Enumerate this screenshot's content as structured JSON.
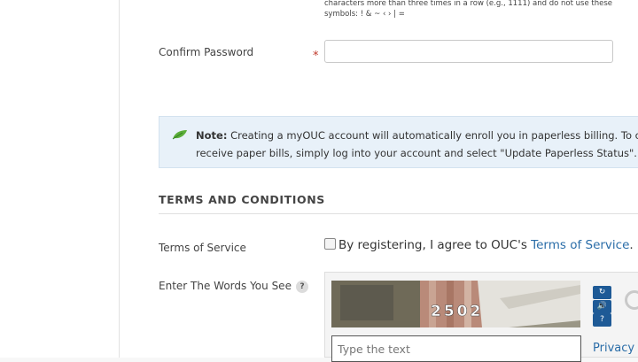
{
  "password_hint": "characters more than three times in a row (e.g., 1111) and do not use these symbols: ! & ~ ‹ › | =",
  "confirm_password": {
    "label": "Confirm Password",
    "required_marker": "*",
    "value": ""
  },
  "note": {
    "prefix": "Note:",
    "line1": " Creating a myOUC account will automatically enroll you in paperless billing. To conti",
    "line2": "receive paper bills, simply log into your account and select \"Update Paperless Status\"."
  },
  "terms_section": {
    "title": "TERMS AND CONDITIONS",
    "tos_label": "Terms of Service",
    "checkbox_text": "By registering, I agree to OUC's ",
    "checkbox_link": "Terms of Service",
    "checkbox_suffix": ".",
    "checked": false
  },
  "captcha": {
    "label": "Enter The Words You See",
    "help_icon_text": "?",
    "image_text": "2502",
    "input_placeholder": "Type the text",
    "privacy_link": "Privacy",
    "buttons": [
      "refresh-icon",
      "audio-icon",
      "help-icon"
    ]
  },
  "colors": {
    "note_bg": "#e8f1f9",
    "link": "#2a6da8",
    "required": "#c0392b",
    "captcha_button": "#1e5a96"
  }
}
